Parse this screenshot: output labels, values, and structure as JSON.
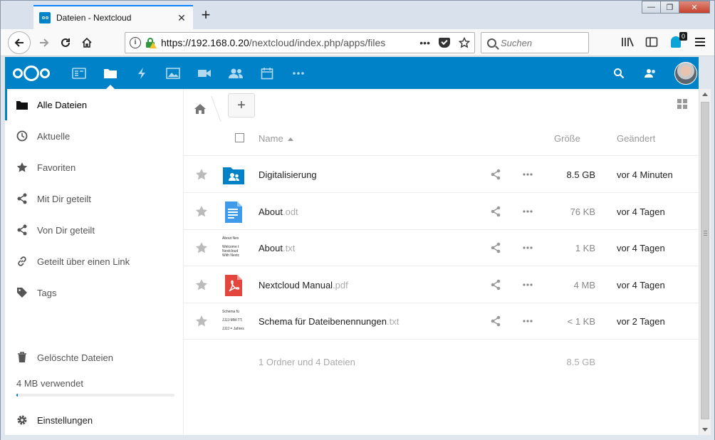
{
  "browser": {
    "tab_title": "Dateien - Nextcloud",
    "tab_close": "✕",
    "new_tab": "+",
    "url_host": "https://192.168.0.20",
    "url_path": "/nextcloud/index.php/apps/files",
    "url_more": "•••",
    "search_placeholder": "Suchen",
    "extension_badge": "0",
    "win_min": "—",
    "win_max": "❐",
    "win_close": "✕"
  },
  "sidebar": {
    "items": [
      {
        "label": "Alle Dateien",
        "icon": "folder-icon"
      },
      {
        "label": "Aktuelle",
        "icon": "clock-icon"
      },
      {
        "label": "Favoriten",
        "icon": "star-icon"
      },
      {
        "label": "Mit Dir geteilt",
        "icon": "share-icon"
      },
      {
        "label": "Von Dir geteilt",
        "icon": "share-icon"
      },
      {
        "label": "Geteilt über einen Link",
        "icon": "link-icon"
      },
      {
        "label": "Tags",
        "icon": "tag-icon"
      }
    ],
    "trash_label": "Gelöschte Dateien",
    "quota_text": "4 MB verwendet",
    "quota_fraction": 0.01,
    "settings_label": "Einstellungen"
  },
  "toolbar": {
    "add_label": "+"
  },
  "table": {
    "col_name": "Name",
    "col_size": "Größe",
    "col_modified": "Geändert",
    "rows": [
      {
        "name": "Digitalisierung",
        "ext": "",
        "size": "8.5 GB",
        "modified": "vor 4 Minuten",
        "type": "shared-folder"
      },
      {
        "name": "About",
        "ext": ".odt",
        "size": "76 KB",
        "modified": "vor 4 Tagen",
        "type": "odt"
      },
      {
        "name": "About",
        "ext": ".txt",
        "size": "1 KB",
        "modified": "vor 4 Tagen",
        "type": "txt"
      },
      {
        "name": "Nextcloud Manual",
        "ext": ".pdf",
        "size": "4 MB",
        "modified": "vor 4 Tagen",
        "type": "pdf"
      },
      {
        "name": "Schema für Dateibenennungen",
        "ext": ".txt",
        "size": "< 1 KB",
        "modified": "vor 2 Tagen",
        "type": "txt2"
      }
    ],
    "summary_text": "1 Ordner und 4 Dateien",
    "summary_size": "8.5 GB"
  },
  "thumbs": {
    "about_txt": [
      "About Nex",
      "",
      "Welcome t",
      "Nextcloud",
      "With Nextc"
    ],
    "schema_txt": [
      "Schema fü",
      "",
      "JJJJ-MM-TT,",
      "",
      "JJJJ = Jahres"
    ]
  },
  "colors": {
    "brand": "#0082c9",
    "pdf": "#e2463c",
    "doc": "#3d9be9"
  }
}
